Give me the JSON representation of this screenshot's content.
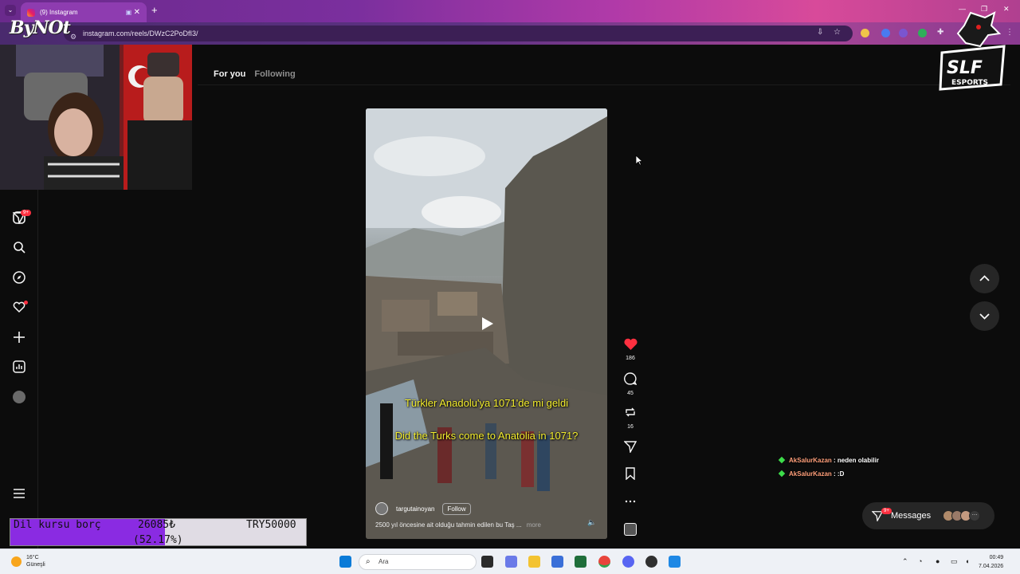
{
  "browser": {
    "tab_title": "(9) Instagram",
    "url": "instagram.com/reels/DWzC2PoDfI3/",
    "new_tab_label": "+"
  },
  "overlay_logo": "ByNOt",
  "feed": {
    "tabs": [
      {
        "label": "For you",
        "active": true
      },
      {
        "label": "Following",
        "active": false
      }
    ]
  },
  "sidebar": {
    "notification_badge": "9+"
  },
  "reel": {
    "caption_tr": "Türkler Anadolu'ya 1071'de mi geldi",
    "caption_en": "Did the Turks come to Anatolia in 1071?",
    "username": "targutainoyan",
    "follow_label": "Follow",
    "description": "2500 yıl öncesine ait olduğu tahmin edilen bu Taş ...",
    "more_label": "more"
  },
  "actions": {
    "likes": "186",
    "comments": "45",
    "reposts": "16"
  },
  "chat": [
    {
      "user": "AkSalurKazan",
      "message": ": neden olabilir"
    },
    {
      "user": "AkSalurKazan",
      "message": ": :D"
    }
  ],
  "messages": {
    "label": "Messages",
    "badge": "9+"
  },
  "donation_bar": {
    "label": "Dil kursu borç",
    "current": "26085₺",
    "percent_text": "(52.17%)",
    "goal": "TRY50000",
    "progress": 0.5217
  },
  "taskbar": {
    "temperature": "16°C",
    "weather": "Güneşli",
    "search_placeholder": "Ara",
    "time": "00:49",
    "date": "7.04.2026"
  },
  "colors": {
    "accent_like": "#ff3040",
    "caption_yellow": "#f4ee2e",
    "chat_user": "#ff9f7a",
    "progress_fill": "#8a2be2"
  }
}
